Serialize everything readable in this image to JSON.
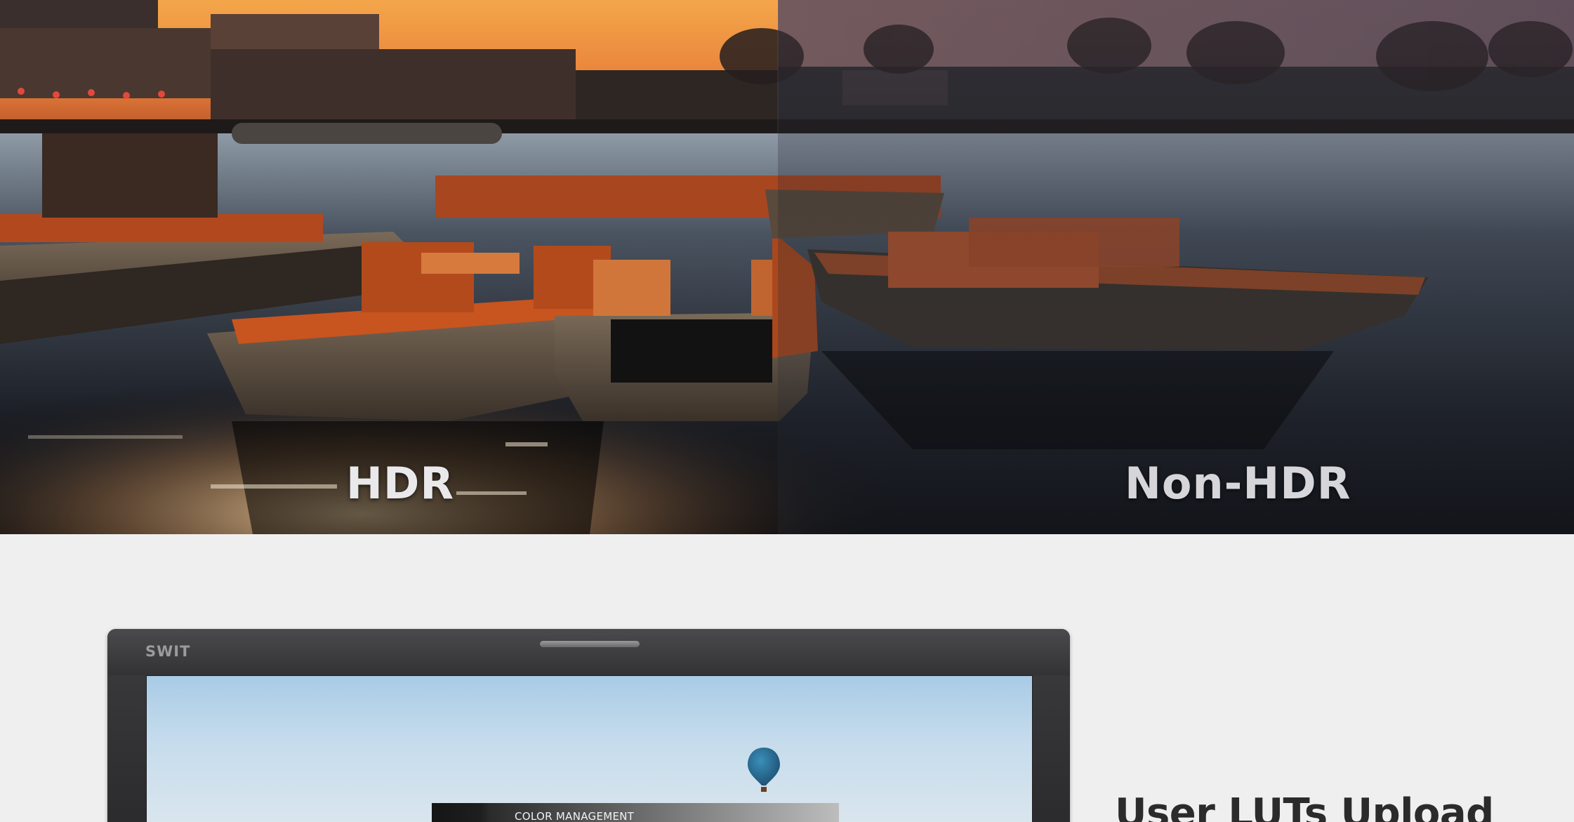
{
  "banner": {
    "left_label": "HDR",
    "right_label": "Non-HDR"
  },
  "monitor": {
    "brand": "SWIT",
    "menu_title": "COLOR MANAGEMENT"
  },
  "feature": {
    "title": "User LUTs Upload"
  },
  "colors": {
    "page_background": "#efefef",
    "title_text": "#2b2b2b",
    "label_text": "#e9e9ec",
    "boat_orange": "#c8541f",
    "water_dark": "#15171c"
  }
}
